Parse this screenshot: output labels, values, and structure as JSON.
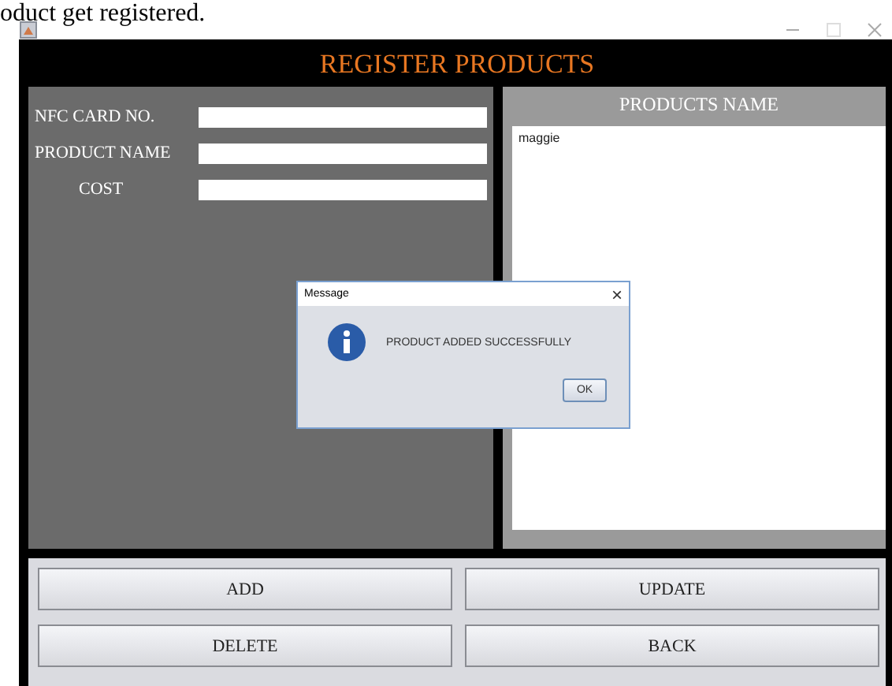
{
  "caption": "oduct get registered.",
  "window": {
    "title": "REGISTER PRODUCTS"
  },
  "form": {
    "fields": [
      {
        "label": "NFC CARD NO."
      },
      {
        "label": "PRODUCT NAME"
      },
      {
        "label": "COST"
      }
    ]
  },
  "products_panel": {
    "heading": "PRODUCTS NAME",
    "items": [
      "maggie"
    ]
  },
  "buttons": [
    "ADD",
    "UPDATE",
    "DELETE",
    "BACK"
  ],
  "dialog": {
    "title": "Message",
    "close": "×",
    "message": "PRODUCT ADDED SUCCESSFULLY",
    "button": "OK"
  }
}
